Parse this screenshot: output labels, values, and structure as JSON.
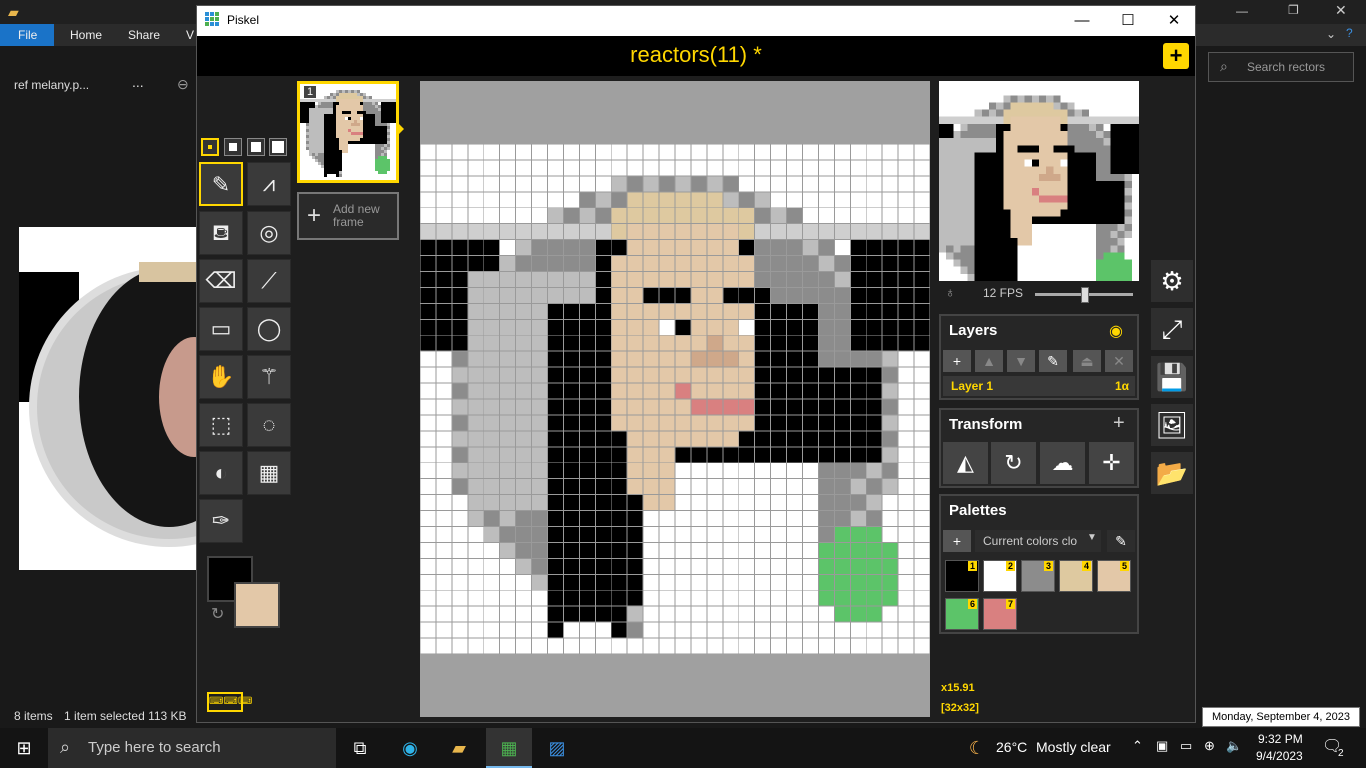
{
  "explorer": {
    "ribbon_tabs": [
      "File",
      "Home",
      "Share",
      "V"
    ],
    "breadcrumb_item": "ref melany.p...",
    "more": "...",
    "search_placeholder": "Search rectors",
    "status_items": "8 items",
    "status_selected": "1 item selected  113 KB"
  },
  "window": {
    "title": "Piskel",
    "minimize": "—",
    "maximize": "☐",
    "close": "✕"
  },
  "app": {
    "document_title": "reactors(11) *",
    "new_button": "+"
  },
  "frames": {
    "frame_number": "1",
    "add_frame_label": "Add new frame"
  },
  "preview": {
    "fps_label": "12 FPS",
    "zoom": "x15.91",
    "size": "[32x32]"
  },
  "layers": {
    "title": "Layers",
    "items": [
      {
        "name": "Layer 1",
        "alpha": "1α"
      }
    ]
  },
  "transform": {
    "title": "Transform"
  },
  "palettes": {
    "title": "Palettes",
    "selected": "Current colors clo",
    "swatches": [
      {
        "num": "1",
        "color": "#000000"
      },
      {
        "num": "2",
        "color": "#ffffff"
      },
      {
        "num": "3",
        "color": "#8c8c8c"
      },
      {
        "num": "4",
        "color": "#dec9a0"
      },
      {
        "num": "5",
        "color": "#e3c8a8"
      },
      {
        "num": "6",
        "color": "#5cc469"
      },
      {
        "num": "7",
        "color": "#d98080"
      }
    ]
  },
  "colors": {
    "primary": "#000000",
    "secondary": "#e3c8a8",
    "accent": "#ffd700"
  },
  "taskbar": {
    "search_placeholder": "Type here to search",
    "weather_temp": "26°C",
    "weather_text": "Mostly clear",
    "time": "9:32 PM",
    "date": "9/4/2023",
    "notification_count": "2",
    "tooltip": "Monday, September 4, 2023"
  }
}
